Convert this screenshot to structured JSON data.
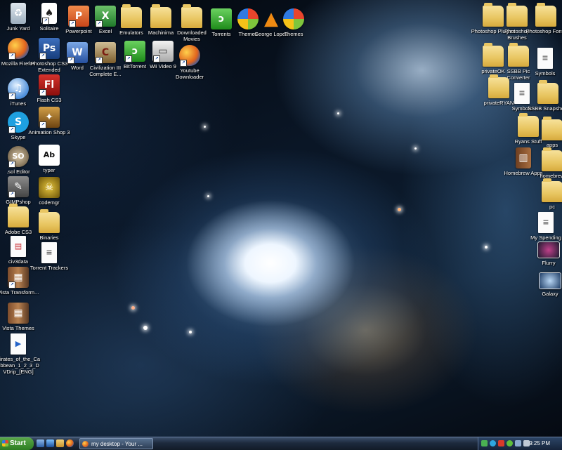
{
  "desktop_icons": {
    "junk_yard": "Junk Yard",
    "solitaire": "Solitaire",
    "powerpoint": "Powerpoint",
    "excel": "Excel",
    "emulators": "Emulators",
    "machinima": "Machinima",
    "downloaded_movies": "Downloaded Movies",
    "torrents": "Torrents",
    "themes1": "Themes",
    "george_lopez": "George Lopez",
    "themes2": "Themes",
    "mozilla_firefox": "Mozilla Firefox",
    "photoshop_cs3_extended": "Photoshop CS3 Extended",
    "word": "Word",
    "civilization": "Civilization III Complete E...",
    "bittorrent": "BitTorrent",
    "wii_video": "Wii Video 9",
    "youtube_downloader": "Youtube Downloader",
    "itunes": "iTunes",
    "flash_cs3": "Flash CS3",
    "skype": "Skype",
    "animation_shop": "Animation Shop 3",
    "sol_editor": ".sol Editor",
    "typer": "typer",
    "gimpshop": "GIMPshop",
    "codemgr": "codemgr",
    "adobe_cs3": "Adobe CS3",
    "binaries": "Binaries",
    "civ3data": "civ3data",
    "torrent_trackers": "Torrent Trackers",
    "vista_transform": "Vista Transform...",
    "vista_themes": "Vista Themes",
    "pirates": "Pirates_of_the_Caribbean_1_2_3_DVDrip_[ENG]",
    "photoshop_plugins": "Photoshop Plugins",
    "photoshop_brushes": "Photoshop Brushes",
    "photoshop_fonts": "Photoshop Fonts",
    "private_ok": "privateOK",
    "ssbb_pic_converter": "SSBB Pic Converter",
    "symbols1": "Symbols",
    "private_ryan": "privateRYAN",
    "symbols2": "Symbols",
    "ssbb_snapshots": "SSBB Snapshots",
    "ryans_stuff": "Ryans Stuff",
    "apps": "apps",
    "homebrew_apps": "Homebrew Apps",
    "homebrew": "homebrew",
    "pc": "pc",
    "my_spending": "My Spending",
    "flurry": "Flurry",
    "galaxy": "Galaxy"
  },
  "taskbar": {
    "start_label": "Start",
    "window_button": "my desktop - Your ...",
    "clock": "9:25 PM"
  },
  "colors": {
    "taskbar": "#1d2a3d",
    "start_green": "#2d7d22",
    "folder": "#e8c560"
  }
}
